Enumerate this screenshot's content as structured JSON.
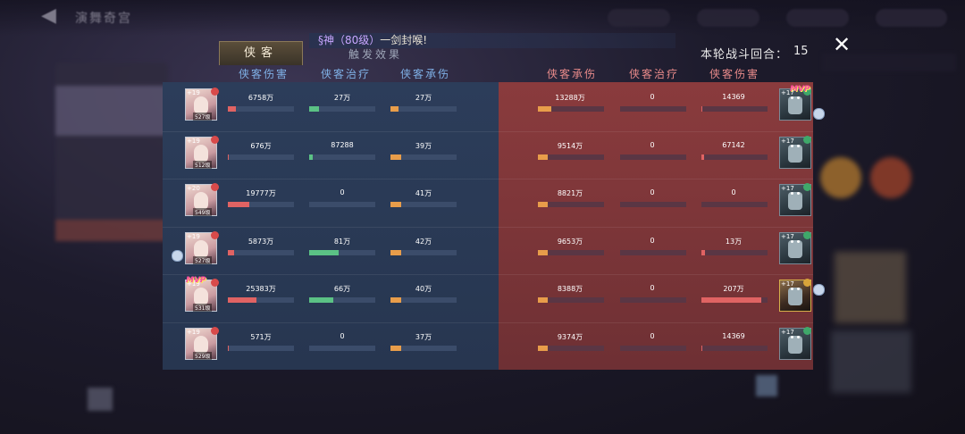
{
  "background": {
    "title": "演舞奇宫"
  },
  "banner": {
    "prefix": "§神（80级）",
    "message": "一剑封喉!"
  },
  "tabs": [
    {
      "label": "侠客",
      "active": true
    },
    {
      "label": "触发效果",
      "active": false
    }
  ],
  "round": {
    "label": "本轮战斗回合：",
    "value": "15"
  },
  "columns": {
    "left": [
      "侠客伤害",
      "侠客治疗",
      "侠客承伤"
    ],
    "right": [
      "侠客承伤",
      "侠客治疗",
      "侠客伤害"
    ]
  },
  "colors": {
    "damage": "#e06363",
    "heal": "#5bc285",
    "tank": "#e89d4a",
    "left_panel": "#2c3d5a",
    "right_panel": "#8a3b3d"
  },
  "left_rows": [
    {
      "level": "19",
      "power": "527级",
      "mvp": false,
      "damage": "6758万",
      "damage_pct": 0.12,
      "heal": "27万",
      "heal_pct": 0.15,
      "tank": "27万",
      "tank_pct": 0.12
    },
    {
      "level": "19",
      "power": "512级",
      "mvp": false,
      "damage": "676万",
      "damage_pct": 0.02,
      "heal": "87288",
      "heal_pct": 0.05,
      "tank": "39万",
      "tank_pct": 0.16
    },
    {
      "level": "20",
      "power": "549级",
      "mvp": false,
      "damage": "19777万",
      "damage_pct": 0.33,
      "heal": "0",
      "heal_pct": 0,
      "tank": "41万",
      "tank_pct": 0.16
    },
    {
      "level": "19",
      "power": "527级",
      "mvp": false,
      "damage": "5873万",
      "damage_pct": 0.1,
      "heal": "81万",
      "heal_pct": 0.45,
      "tank": "42万",
      "tank_pct": 0.16
    },
    {
      "level": "19",
      "power": "531级",
      "mvp": true,
      "damage": "25383万",
      "damage_pct": 0.43,
      "heal": "66万",
      "heal_pct": 0.36,
      "tank": "40万",
      "tank_pct": 0.16
    },
    {
      "level": "19",
      "power": "529级",
      "mvp": false,
      "damage": "571万",
      "damage_pct": 0.02,
      "heal": "0",
      "heal_pct": 0,
      "tank": "37万",
      "tank_pct": 0.16
    }
  ],
  "right_rows": [
    {
      "level": "17",
      "mvp": true,
      "tank": "13288万",
      "tank_pct": 0.2,
      "heal": "0",
      "heal_pct": 0,
      "damage": "14369",
      "damage_pct": 0.02
    },
    {
      "level": "17",
      "mvp": false,
      "tank": "9514万",
      "tank_pct": 0.15,
      "heal": "0",
      "heal_pct": 0,
      "damage": "67142",
      "damage_pct": 0.04
    },
    {
      "level": "17",
      "mvp": false,
      "tank": "8821万",
      "tank_pct": 0.15,
      "heal": "0",
      "heal_pct": 0,
      "damage": "0",
      "damage_pct": 0
    },
    {
      "level": "17",
      "mvp": false,
      "tank": "9653万",
      "tank_pct": 0.15,
      "heal": "0",
      "heal_pct": 0,
      "damage": "13万",
      "damage_pct": 0.06
    },
    {
      "level": "17",
      "mvp": false,
      "tank": "8388万",
      "tank_pct": 0.15,
      "heal": "0",
      "heal_pct": 0,
      "damage": "207万",
      "damage_pct": 0.9
    },
    {
      "level": "17",
      "mvp": false,
      "tank": "9374万",
      "tank_pct": 0.15,
      "heal": "0",
      "heal_pct": 0,
      "damage": "14369",
      "damage_pct": 0.02
    }
  ]
}
